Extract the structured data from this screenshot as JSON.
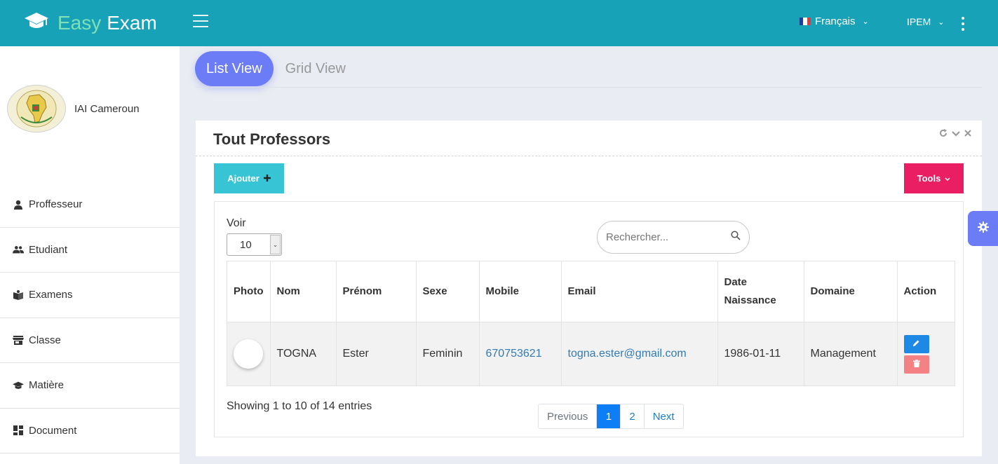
{
  "header": {
    "brand_word1": "Easy",
    "brand_word2": "Exam",
    "language": "Français",
    "user": "IPEM",
    "colors": {
      "bar": "#17a2b8",
      "brand_accent": "#7fe0b8"
    }
  },
  "sidebar": {
    "profile_name": "IAI Cameroun",
    "items": [
      {
        "label": "Proffesseur",
        "icon": "person-icon"
      },
      {
        "label": "Etudiant",
        "icon": "people-icon"
      },
      {
        "label": "Examens",
        "icon": "book-icon"
      },
      {
        "label": "Classe",
        "icon": "store-icon"
      },
      {
        "label": "Matière",
        "icon": "graduation-cap-icon"
      },
      {
        "label": "Document",
        "icon": "dashboard-icon"
      }
    ]
  },
  "views": {
    "list": "List View",
    "grid": "Grid View",
    "active": "list"
  },
  "card": {
    "title": "Tout Professors",
    "add_label": "Ajouter",
    "tools_label": "Tools"
  },
  "table_controls": {
    "voir_label": "Voir",
    "page_size": "10",
    "search_placeholder": "Rechercher..."
  },
  "table": {
    "headers": {
      "photo": "Photo",
      "nom": "Nom",
      "prenom": "Prénom",
      "sexe": "Sexe",
      "mobile": "Mobile",
      "email": "Email",
      "date_line1": "Date",
      "date_line2": "Naissance",
      "domaine": "Domaine",
      "action": "Action"
    },
    "rows": [
      {
        "nom": "TOGNA",
        "prenom": "Ester",
        "sexe": "Feminin",
        "mobile": "670753621",
        "email": "togna.ester@gmail.com",
        "date_naissance": "1986-01-11",
        "domaine": "Management"
      }
    ]
  },
  "pagination": {
    "summary": "Showing 1 to 10 of 14 entries",
    "previous": "Previous",
    "pages": [
      "1",
      "2"
    ],
    "current": "1",
    "next": "Next"
  }
}
